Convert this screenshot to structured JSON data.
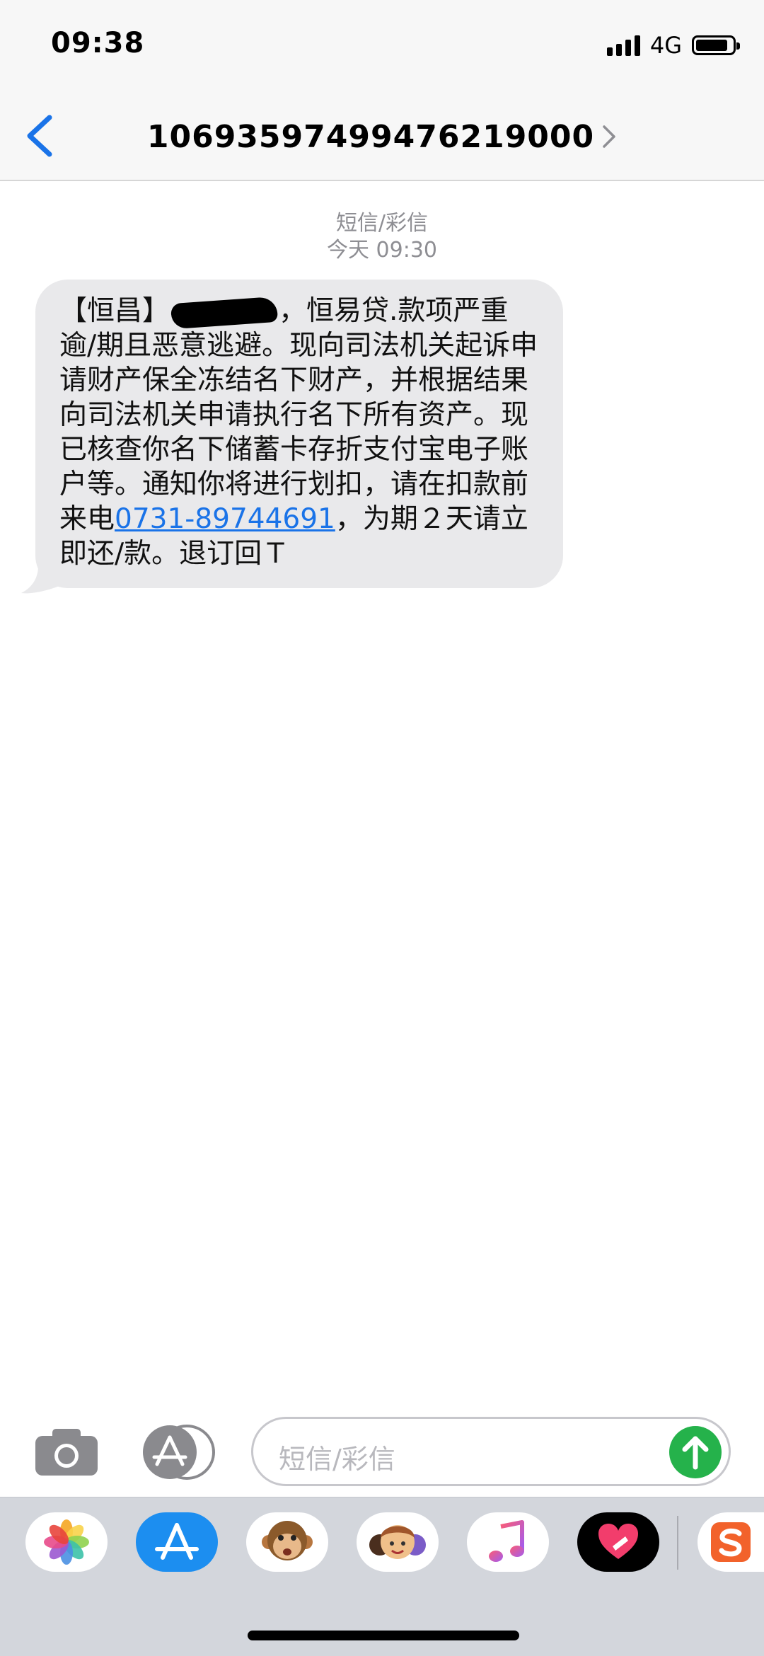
{
  "status_bar": {
    "time": "09:38",
    "network": "4G"
  },
  "nav": {
    "contact": "106935974994762190​00"
  },
  "conversation": {
    "kind_label": "短信/彩信",
    "timestamp": "今天 09:30",
    "message": {
      "part1": "【恒昌】",
      "part2": "，恒易贷.款项严重逾/期且恶意逃避。现向司法机关起诉申请财产保全冻结名下财产，并根据结果向司法机关申请执行名下所有资产。现已核查你名下储蓄卡存折支付宝电子账户等。通知你将进行划扣，请在扣款前来电",
      "phone": "0731-89744691",
      "part3": "，为期２天请立即还/款。退订回Ｔ"
    }
  },
  "input_bar": {
    "placeholder": "短信/彩信"
  },
  "colors": {
    "accent": "#1a73e8",
    "send": "#25b24b",
    "bubble": "#e9e9eb"
  },
  "app_drawer": {
    "apps": [
      "photos-icon",
      "app-store-icon",
      "animoji-icon",
      "memoji-icon",
      "music-icon",
      "digital-touch-icon",
      "sogou-icon"
    ]
  }
}
